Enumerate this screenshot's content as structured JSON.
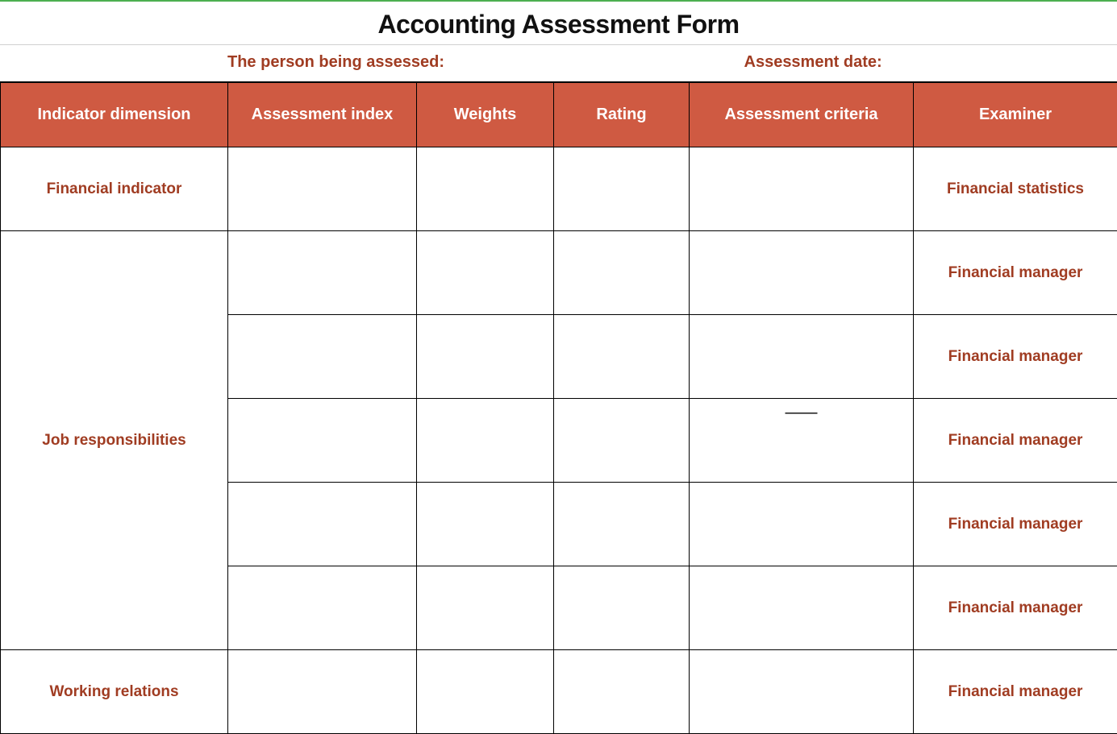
{
  "title": "Accounting Assessment Form",
  "subhead": {
    "assessee_label": "The person being assessed:",
    "date_label": "Assessment date:"
  },
  "columns": {
    "dimension": "Indicator dimension",
    "index": "Assessment index",
    "weights": "Weights",
    "rating": "Rating",
    "criteria": "Assessment criteria",
    "examiner": "Examiner"
  },
  "rows": [
    {
      "dimension": "Financial indicator",
      "dimension_rowspan": 1,
      "index": "",
      "weights": "",
      "rating": "",
      "criteria": "",
      "examiner": "Financial statistics"
    },
    {
      "dimension": "Job responsibilities",
      "dimension_rowspan": 5,
      "index": "",
      "weights": "",
      "rating": "",
      "criteria": "",
      "examiner": "Financial manager"
    },
    {
      "index": "",
      "weights": "",
      "rating": "",
      "criteria": "",
      "examiner": "Financial manager"
    },
    {
      "index": "",
      "weights": "",
      "rating": "",
      "criteria": "——",
      "examiner": "Financial manager"
    },
    {
      "index": "",
      "weights": "",
      "rating": "",
      "criteria": "",
      "examiner": "Financial manager"
    },
    {
      "index": "",
      "weights": "",
      "rating": "",
      "criteria": "",
      "examiner": "Financial manager"
    },
    {
      "dimension": "Working relations",
      "dimension_rowspan": 1,
      "index": "",
      "weights": "",
      "rating": "",
      "criteria": "",
      "examiner": "Financial manager"
    }
  ]
}
